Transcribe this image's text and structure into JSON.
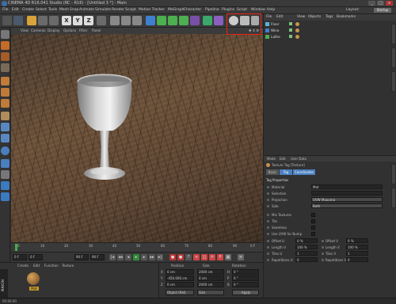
{
  "title_bar": {
    "text": "CINEMA 4D R16.041 Studio (RC - R16) - [Untitled 3 *] - Main",
    "buttons": [
      "_",
      "□",
      "x"
    ]
  },
  "menu": {
    "items": [
      "File",
      "Edit",
      "Create",
      "Select",
      "Tools",
      "Mesh",
      "Snap",
      "Animate",
      "Simulate",
      "Render",
      "Sculpt",
      "Motion Tracker",
      "MoGraph",
      "Character",
      "Pipeline",
      "Plugins",
      "Script",
      "Window",
      "Help"
    ],
    "layout_label": "Layout:",
    "layout_value": "Startup"
  },
  "toolbar": {
    "axis": [
      "X",
      "Y",
      "Z"
    ]
  },
  "viewport_menu": {
    "items": [
      "View",
      "Cameras",
      "Display",
      "Options",
      "Filter",
      "Panel"
    ]
  },
  "object_manager": {
    "menu": [
      "File",
      "Edit",
      "View",
      "Objects",
      "Tags",
      "Bookmarks"
    ],
    "objects": [
      {
        "name": "Floor"
      },
      {
        "name": "Wine"
      },
      {
        "name": "Lathe"
      }
    ]
  },
  "attribute_manager": {
    "menu": [
      "Mode",
      "Edit",
      "User Data"
    ],
    "header": "Texture Tag [Texture]",
    "tabs": [
      "Basic",
      "Tag",
      "Coordinates"
    ],
    "section": "Tag Properties",
    "props": [
      {
        "label": "Material",
        "value": "Mat"
      },
      {
        "label": "Selection",
        "value": ""
      },
      {
        "label": "Projection",
        "value": "UVW Mapping"
      },
      {
        "label": "Side",
        "value": "Both"
      },
      {
        "label": "Mix Textures",
        "value": ""
      },
      {
        "label": "Tile",
        "value": ""
      },
      {
        "label": "Seamless",
        "value": ""
      },
      {
        "label": "Use UVW for Bump",
        "value": ""
      }
    ],
    "offset": [
      {
        "label": "Offset U",
        "value": "0 %",
        "label2": "Offset V",
        "value2": "0 %"
      },
      {
        "label": "Length U",
        "value": "100 %",
        "label2": "Length V",
        "value2": "100 %"
      },
      {
        "label": "Tiles U",
        "value": "1",
        "label2": "Tiles V",
        "value2": "1"
      },
      {
        "label": "Repetitions U",
        "value": "0",
        "label2": "Repetitions V",
        "value2": "0"
      }
    ]
  },
  "timeline": {
    "ticks": [
      "0",
      "10",
      "20",
      "30",
      "40",
      "50",
      "60",
      "70",
      "80",
      "90"
    ],
    "end": "0 F"
  },
  "playback": {
    "start": "0 F",
    "current": "0 F",
    "end": "90 F",
    "end2": "90 F"
  },
  "material_manager": {
    "menu": [
      "Create",
      "Edit",
      "Function",
      "Texture"
    ],
    "material": "Mat"
  },
  "coordinates": {
    "headers": [
      "Position",
      "Size",
      "Rotation"
    ],
    "rows": [
      {
        "axis": "X",
        "pos": "0 cm",
        "size": "2000 cm",
        "rot_axis": "H",
        "rot": "0 °"
      },
      {
        "axis": "Y",
        "pos": "-450.006 cm",
        "size": "0 cm",
        "rot_axis": "P",
        "rot": "0 °"
      },
      {
        "axis": "Z",
        "pos": "0 cm",
        "size": "2000 cm",
        "rot_axis": "B",
        "rot": "0 °"
      }
    ],
    "mode": "Object (Rel)",
    "size_mode": "Size",
    "apply": "Apply"
  },
  "maxon": "MAXON",
  "status": "00:00:00",
  "colors": {
    "highlight": "#e21",
    "accent": "#4a7fbf"
  }
}
